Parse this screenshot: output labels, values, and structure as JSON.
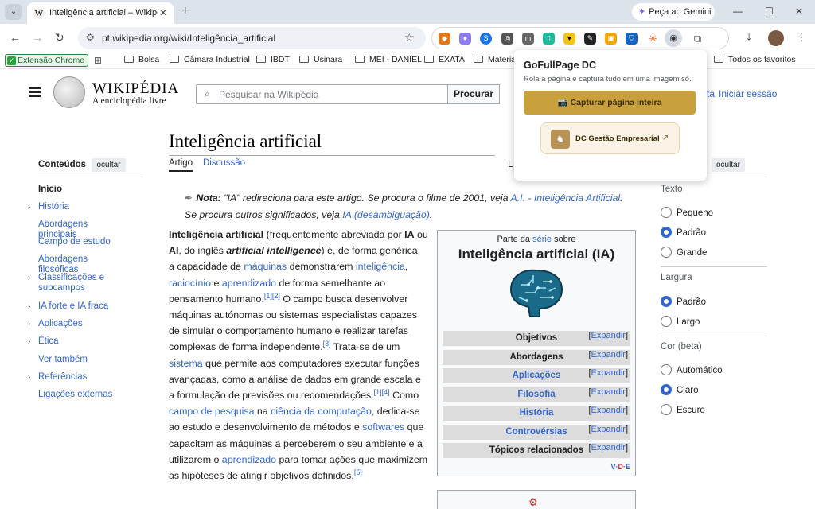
{
  "browser": {
    "tab_title": "Inteligência artificial – Wikipédia",
    "gemini_label": "Peça ao Gemini",
    "url": "pt.wikipedia.org/wiki/Inteligência_artificial",
    "bookmarks": {
      "extension_label": "Extensão Chrome",
      "items": [
        "Bolsa",
        "Câmara Industrial",
        "IBDT",
        "Usinara",
        "MEI - DANIEL",
        "EXATA",
        "Materia"
      ],
      "all_bookmarks": "Todos os favoritos"
    }
  },
  "wiki": {
    "name": "WIKIPÉDIA",
    "tagline": "A enciclopédia livre",
    "search_placeholder": "Pesquisar na Wikipédia",
    "search_button": "Procurar",
    "user_links": [
      "ta",
      "Iniciar sessão"
    ],
    "title": "Inteligência artificial",
    "tabs": [
      "Artigo",
      "Discussão"
    ],
    "lang_letter": "L",
    "toc": {
      "title": "Conteúdos",
      "hide": "ocultar",
      "items": [
        {
          "label": "Início",
          "expandable": false,
          "current": true
        },
        {
          "label": "História",
          "expandable": true
        },
        {
          "label": "Abordagens principais",
          "expandable": false
        },
        {
          "label": "Campo de estudo",
          "expandable": false
        },
        {
          "label": "Abordagens filosóficas",
          "expandable": false
        },
        {
          "label": "Classificações e subcampos",
          "expandable": true
        },
        {
          "label": "IA forte e IA fraca",
          "expandable": true
        },
        {
          "label": "Aplicações",
          "expandable": true
        },
        {
          "label": "Ética",
          "expandable": true
        },
        {
          "label": "Ver também",
          "expandable": false
        },
        {
          "label": "Referências",
          "expandable": true
        },
        {
          "label": "Ligações externas",
          "expandable": false
        }
      ]
    },
    "hatnote": {
      "note_label": "Nota:",
      "text_1": "\"IA\" redireciona para este artigo. Se procura o filme de 2001, veja",
      "link_1": "A.I. - Inteligência Artificial",
      "text_2": ". Se procura outros significados, veja",
      "link_2": "IA (desambiguação)",
      "text_3": "."
    },
    "infobox": {
      "pre_text": "Parte da",
      "pre_link": "série",
      "pre_after": "sobre",
      "title": "Inteligência artificial (IA)",
      "expand_label": "Expandir",
      "rows": [
        {
          "label": "Objetivos",
          "link": false
        },
        {
          "label": "Abordagens",
          "link": false
        },
        {
          "label": "Aplicações",
          "link": true
        },
        {
          "label": "Filosofia",
          "link": true
        },
        {
          "label": "História",
          "link": true
        },
        {
          "label": "Controvérsias",
          "link": true
        },
        {
          "label": "Tópicos relacionados",
          "link": false
        }
      ],
      "vde": [
        "V",
        "D",
        "E"
      ]
    },
    "appearance": {
      "hide": "ocultar",
      "sections": [
        {
          "heading": "Texto",
          "options": [
            "Pequeno",
            "Padrão",
            "Grande"
          ],
          "selected": 1
        },
        {
          "heading": "Largura",
          "options": [
            "Padrão",
            "Largo"
          ],
          "selected": 0
        },
        {
          "heading": "Cor (beta)",
          "options": [
            "Automático",
            "Claro",
            "Escuro"
          ],
          "selected": 1
        }
      ]
    }
  },
  "popup": {
    "title": "GoFullPage DC",
    "subtitle": "Rola a página e captura tudo em uma imagem só.",
    "capture_button": "Capturar página inteira",
    "dc_label": "DC Gestão Empresarial"
  }
}
